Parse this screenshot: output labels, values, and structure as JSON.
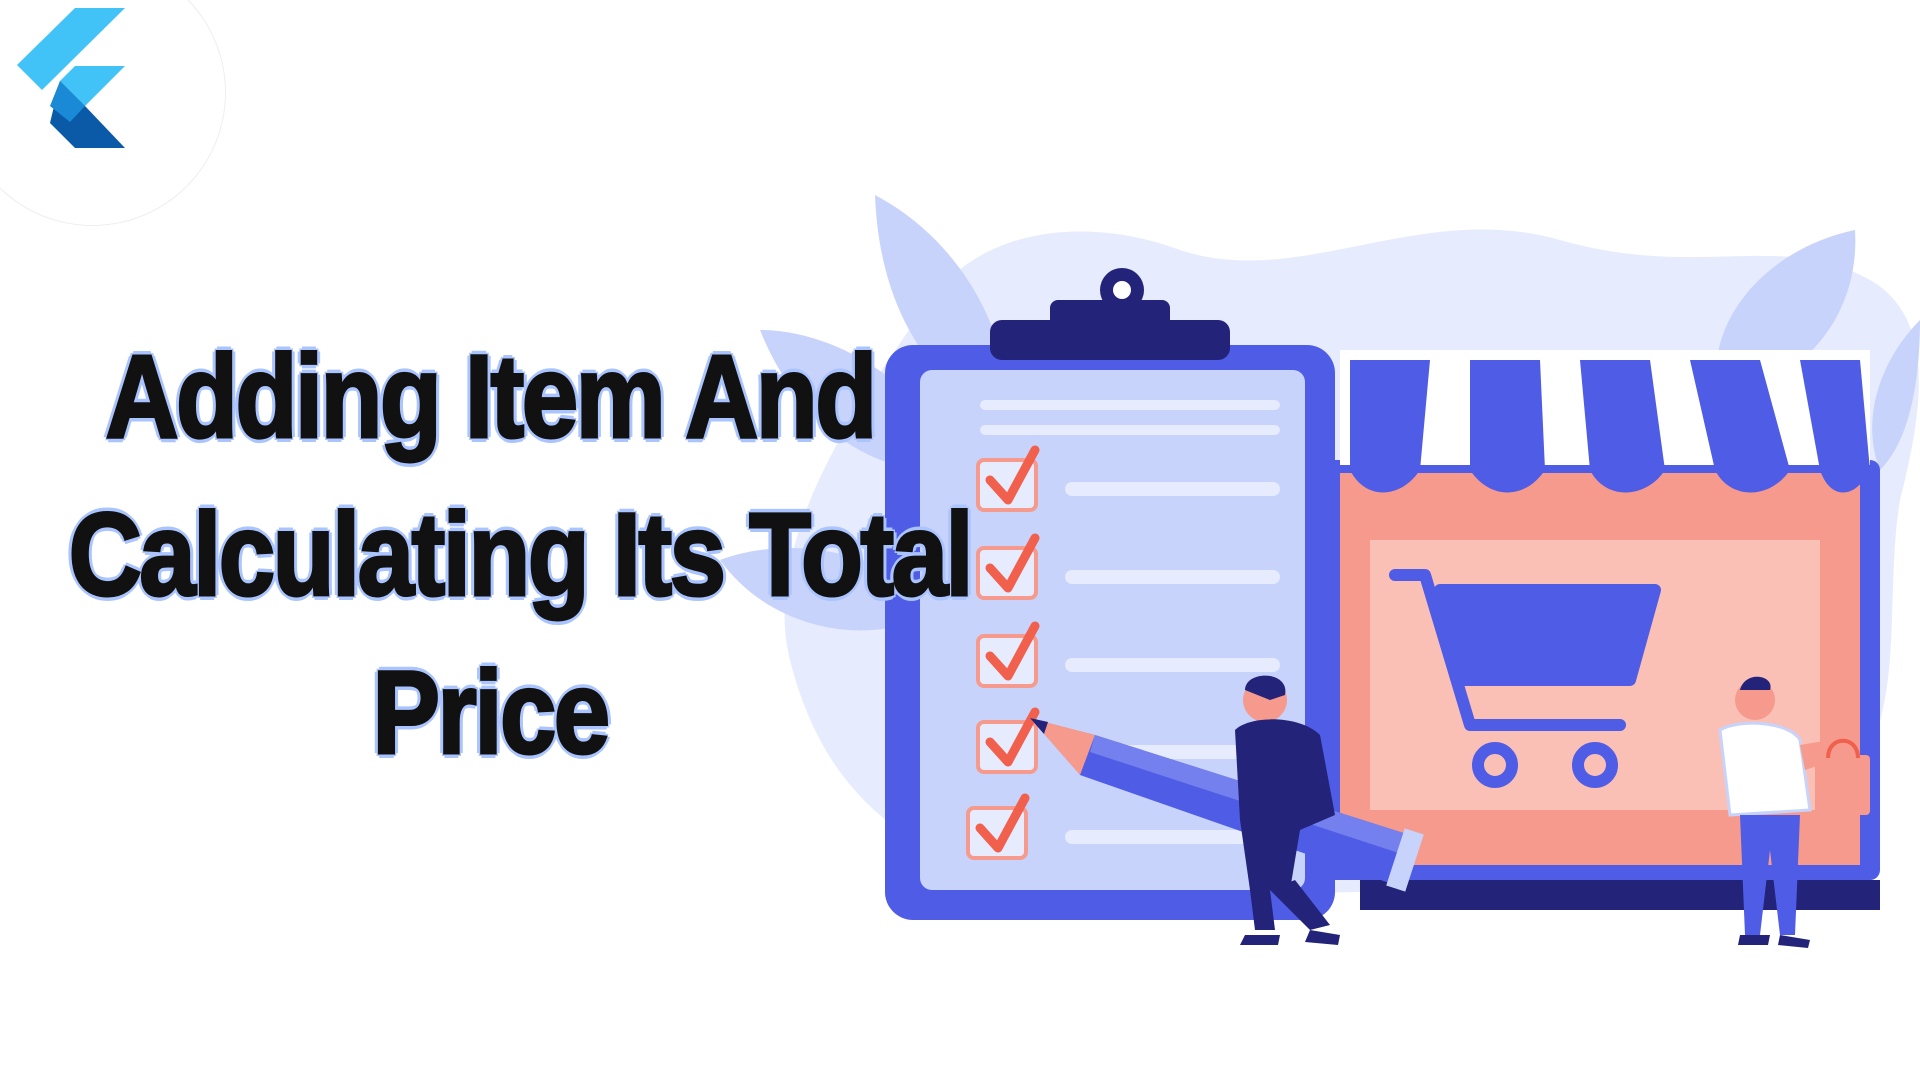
{
  "headline": {
    "line1": "Adding Item And",
    "line2": "Calculating Its Total",
    "line3": "Price"
  },
  "logo": {
    "icon": "flutter-logo-icon"
  },
  "colors": {
    "primary_blue": "#4f5ce6",
    "light_blue": "#c7d3fb",
    "pale_blue": "#e6ebfd",
    "coral": "#f59a8c",
    "check_red": "#f0604c",
    "navy": "#23237a",
    "flutter_light": "#42c3f7",
    "flutter_dark": "#0b5aa8"
  },
  "illustration": {
    "icons": [
      "clipboard-icon",
      "shopping-cart-icon",
      "storefront-icon",
      "pencil-icon",
      "shopping-bag-icon"
    ],
    "checklist_count": 5
  }
}
